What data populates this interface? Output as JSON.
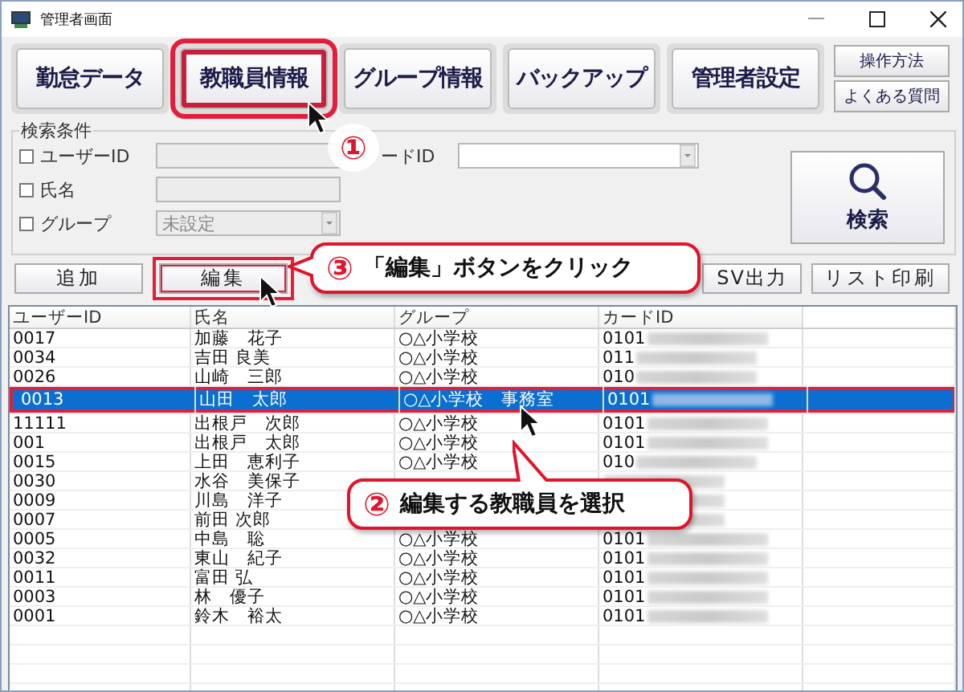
{
  "window": {
    "title": "管理者画面"
  },
  "nav_buttons": [
    {
      "label": "勤怠データ",
      "highlighted": false
    },
    {
      "label": "教職員情報",
      "highlighted": true
    },
    {
      "label": "グループ情報",
      "highlighted": false
    },
    {
      "label": "バックアップ",
      "highlighted": false
    },
    {
      "label": "管理者設定",
      "highlighted": false
    }
  ],
  "help_buttons": [
    "操作方法",
    "よくある質問"
  ],
  "search": {
    "legend": "検索条件",
    "fields": [
      {
        "label": "ユーザーID",
        "checked": false,
        "kind": "text",
        "disabled": true
      },
      {
        "label": "氏名",
        "checked": false,
        "kind": "text",
        "disabled": true
      },
      {
        "label": "グループ",
        "checked": false,
        "kind": "select",
        "disabled": true,
        "value": "未設定"
      }
    ],
    "card_field": {
      "label": "ードID",
      "kind": "select",
      "disabled": false
    },
    "search_button": "検索"
  },
  "actions": [
    {
      "label": "追加",
      "highlighted": false
    },
    {
      "label": "編集",
      "highlighted": true
    },
    {
      "label": "SV出力",
      "highlighted": false
    },
    {
      "label": "リスト印刷",
      "highlighted": false
    }
  ],
  "table": {
    "columns": [
      "ユーザーID",
      "氏名",
      "グループ",
      "カードID"
    ],
    "rows": [
      {
        "id": "0017",
        "name": "加藤　花子",
        "group": "○△小学校",
        "card": "0101",
        "selected": false,
        "highlighted": false
      },
      {
        "id": "0034",
        "name": "吉田 良美",
        "group": "○△小学校",
        "card": "011",
        "selected": false,
        "highlighted": false
      },
      {
        "id": "0026",
        "name": "山崎　三郎",
        "group": "○△小学校",
        "card": "010",
        "selected": false,
        "highlighted": false
      },
      {
        "id": "0013",
        "name": "山田　太郎",
        "group": "○△小学校　事務室",
        "card": "0101",
        "selected": true,
        "highlighted": true
      },
      {
        "id": "11111",
        "name": "出根戸　次郎",
        "group": "○△小学校",
        "card": "0101",
        "selected": false,
        "highlighted": false
      },
      {
        "id": "001",
        "name": "出根戸　太郎",
        "group": "○△小学校",
        "card": "0101",
        "selected": false,
        "highlighted": false
      },
      {
        "id": "0015",
        "name": "上田　恵利子",
        "group": "○△小学校",
        "card": "010",
        "selected": false,
        "highlighted": false
      },
      {
        "id": "0030",
        "name": "水谷　美保子",
        "selected": false,
        "highlighted": false
      },
      {
        "id": "0009",
        "name": "川島　洋子",
        "selected": false,
        "highlighted": false
      },
      {
        "id": "0007",
        "name": "前田 次郎",
        "selected": false,
        "highlighted": false
      },
      {
        "id": "0005",
        "name": "中島　聡",
        "group": "○△小学校",
        "card": "0101",
        "selected": false,
        "highlighted": false
      },
      {
        "id": "0032",
        "name": "東山　紀子",
        "group": "○△小学校",
        "card": "0101",
        "selected": false,
        "highlighted": false
      },
      {
        "id": "0011",
        "name": "富田 弘",
        "group": "○△小学校",
        "card": "0101",
        "selected": false,
        "highlighted": false
      },
      {
        "id": "0003",
        "name": "林　優子",
        "group": "○△小学校",
        "card": "0101",
        "selected": false,
        "highlighted": false
      },
      {
        "id": "0001",
        "name": "鈴木　裕太",
        "group": "○△小学校",
        "card": "0101",
        "selected": false,
        "highlighted": false
      }
    ]
  },
  "callouts": [
    {
      "number": "①"
    },
    {
      "number": "③",
      "text": "「編集」ボタンをクリック"
    },
    {
      "number": "②",
      "text": "編集する教職員を選択"
    }
  ]
}
